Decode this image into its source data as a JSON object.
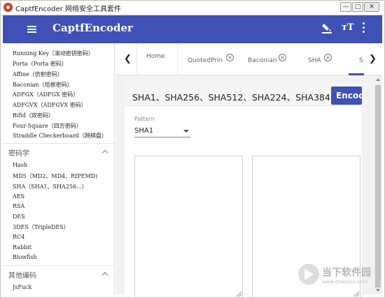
{
  "window": {
    "title": "CaptfEncoder 网络安全工具套件",
    "minimize_label": "—",
    "maximize_label": "□",
    "close_label": "✕"
  },
  "appbar": {
    "menu_icon": "hamburger-menu-icon",
    "title": "CaptfEncoder",
    "actions": [
      {
        "icon": "format-paint-icon"
      },
      {
        "icon": "text-size-icon",
        "glyph": "ᴛT"
      },
      {
        "icon": "more-vert-icon"
      }
    ],
    "color": "#3f51b5"
  },
  "sidebar": {
    "items_top": [
      "Running Key（滚动密钥密码）",
      "Porta（Porta 密码）",
      "Affine（仿射密码）",
      "Baconian（培根密码）",
      "ADFGX（ADFGX 密码）",
      "ADFGVX（ADFGVX 密码）",
      "Bifid（双密码）",
      "Four-Square（四方密码）",
      "Straddle Checkerboard（跨棋盘）"
    ],
    "section_crypto": "密码学",
    "items_crypto": [
      "Hash",
      "MD5（MD2、MD4、RIPEMD)",
      "SHA（SHA1、SHA256...）",
      "AES",
      "RSA",
      "DES",
      "3DES（TripleDES）",
      "RC4",
      "Rabbit",
      "Blowfish"
    ],
    "section_other": "其他编码",
    "items_other": [
      "JsFuck"
    ]
  },
  "tabs": {
    "left_arrow": "❮",
    "right_arrow": "❯",
    "items": [
      {
        "label": "Home",
        "closable": false
      },
      {
        "label": "QuotedPrin",
        "closable": true
      },
      {
        "label": "Baconian",
        "closable": true
      },
      {
        "label": "SHA",
        "closable": true
      },
      {
        "label": "S",
        "closable": false,
        "active": true
      }
    ],
    "close_glyph": "×",
    "accent": "#3f51b5"
  },
  "main": {
    "title": "SHA1、SHA256、SHA512、SHA224、SHA384",
    "encode_button": "Encode",
    "pattern_label": "Pattern",
    "pattern_value": "SHA1",
    "input_value": "",
    "output_value": ""
  },
  "watermark": {
    "text": "当下软件园",
    "url": "www.downxia.com"
  }
}
